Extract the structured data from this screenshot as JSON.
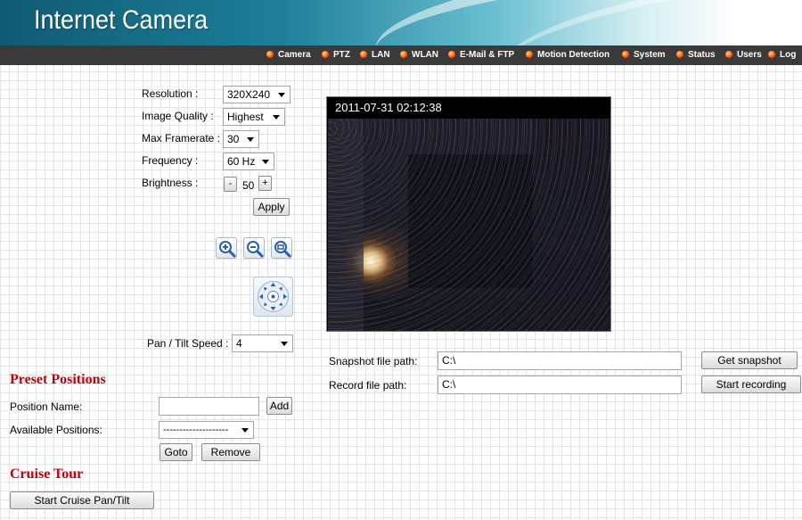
{
  "header": {
    "title": "Internet Camera"
  },
  "nav": [
    {
      "label": "Camera"
    },
    {
      "label": "PTZ"
    },
    {
      "label": "LAN"
    },
    {
      "label": "WLAN"
    },
    {
      "label": "E-Mail & FTP"
    },
    {
      "label": "Motion Detection"
    },
    {
      "label": "System"
    },
    {
      "label": "Status"
    },
    {
      "label": "Users"
    },
    {
      "label": "Log"
    }
  ],
  "settings": {
    "resolution": {
      "label": "Resolution :",
      "value": "320X240"
    },
    "image_quality": {
      "label": "Image Quality :",
      "value": "Highest"
    },
    "max_framerate": {
      "label": "Max Framerate :",
      "value": "30"
    },
    "frequency": {
      "label": "Frequency :",
      "value": "60 Hz"
    },
    "brightness": {
      "label": "Brightness :",
      "minus": "-",
      "value": "50",
      "plus": "+"
    },
    "apply_label": "Apply"
  },
  "ptz": {
    "zoom_in_icon": "zoom-in-icon",
    "zoom_out_icon": "zoom-out-icon",
    "zoom_reset_icon": "zoom-reset-icon",
    "pad_icon": "directional-pad-icon",
    "speed": {
      "label": "Pan / Tilt Speed :",
      "value": "4"
    }
  },
  "video": {
    "timestamp": "2011-07-31 02:12:38"
  },
  "capture": {
    "snapshot_label": "Snapshot file path:",
    "snapshot_path": "C:\\",
    "snapshot_button": "Get snapshot",
    "record_label": "Record file path:",
    "record_path": "C:\\",
    "record_button": "Start recording"
  },
  "presets": {
    "title": "Preset Positions",
    "name_label": "Position Name:",
    "name_value": "",
    "add_button": "Add",
    "available_label": "Available Positions:",
    "available_value": "--------------------",
    "goto_button": "Goto",
    "remove_button": "Remove"
  },
  "cruise": {
    "title": "Cruise Tour",
    "button": "Start Cruise Pan/Tilt"
  },
  "colors": {
    "nav_bg": "#3a3a3a",
    "section_title": "#c0000b",
    "nav_dot": "#ff5500"
  }
}
